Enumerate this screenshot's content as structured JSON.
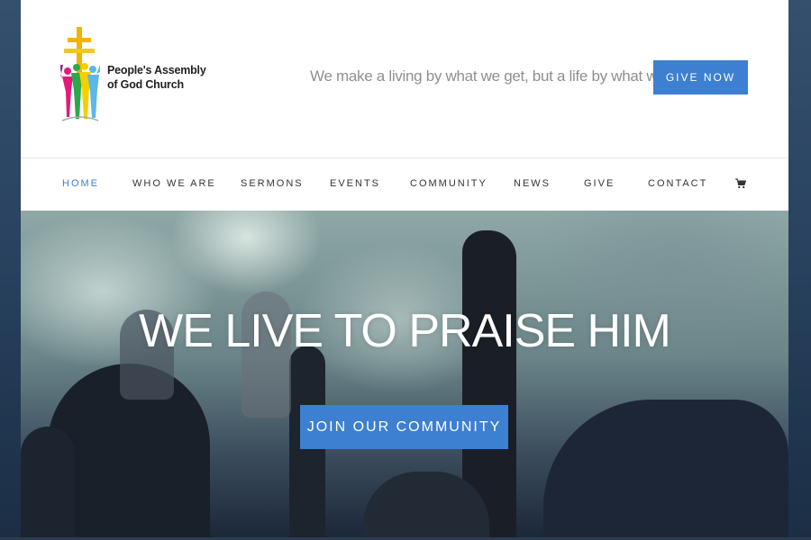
{
  "header": {
    "logo_line1": "People's Assembly",
    "logo_line2": "of God Church",
    "tagline": "We make a living by what we get, but a life by what we give.",
    "give_now_label": "GIVE NOW"
  },
  "nav": {
    "items": [
      {
        "label": "HOME",
        "active": true
      },
      {
        "label": "WHO WE ARE",
        "active": false
      },
      {
        "label": "SERMONS",
        "active": false
      },
      {
        "label": "EVENTS",
        "active": false
      },
      {
        "label": "COMMUNITY",
        "active": false
      },
      {
        "label": "NEWS",
        "active": false
      },
      {
        "label": "GIVE",
        "active": false
      },
      {
        "label": "CONTACT",
        "active": false
      }
    ],
    "cart_icon": "shopping-cart-icon"
  },
  "hero": {
    "title": "WE LIVE TO PRAISE HIM",
    "cta_label": "JOIN OUR COMMUNITY"
  },
  "colors": {
    "accent": "#3d7fd0",
    "nav_text": "#333333",
    "tagline": "#8f8f8f"
  }
}
